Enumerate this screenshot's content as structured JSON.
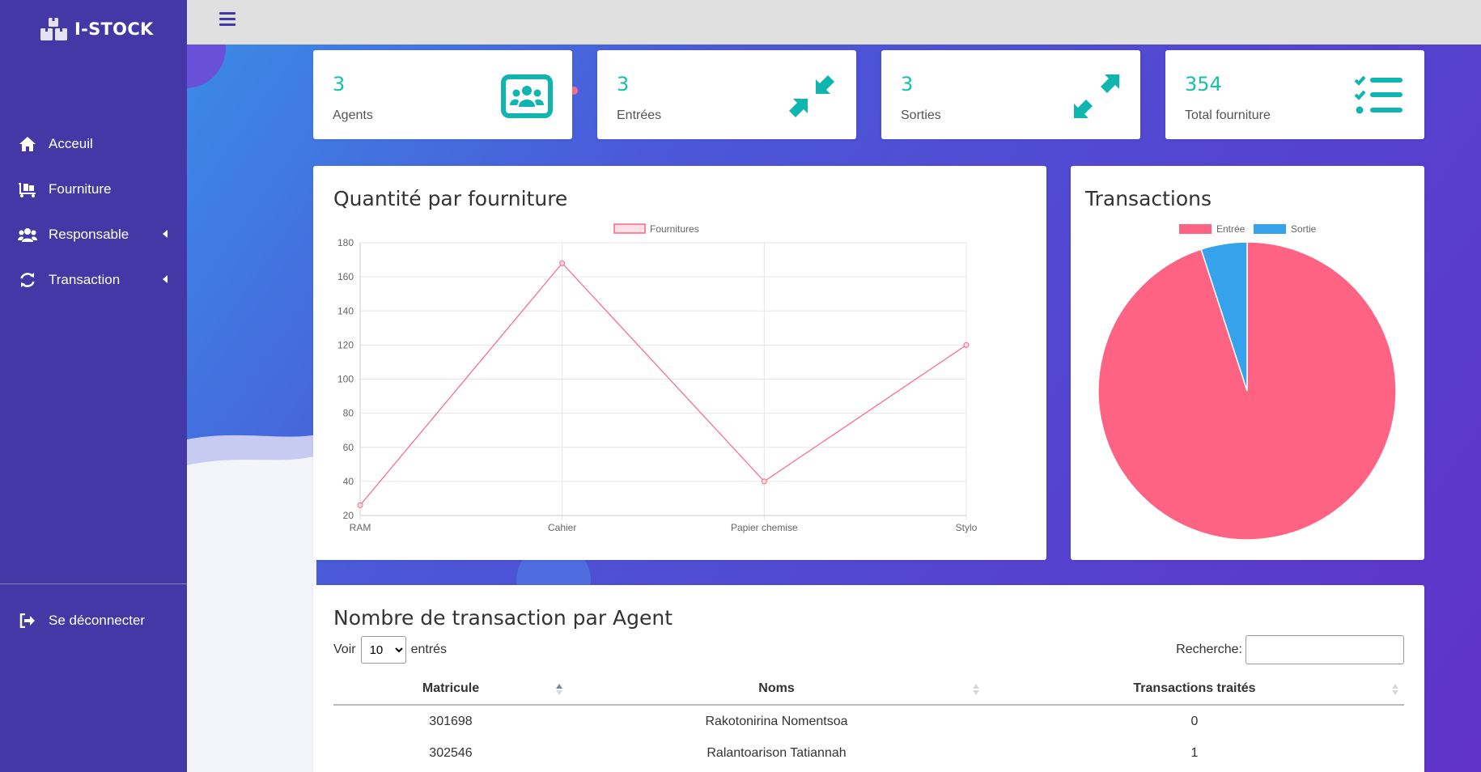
{
  "app": {
    "brand": "I-STOCK"
  },
  "sidebar": {
    "items": [
      {
        "label": "Acceuil",
        "icon": "home-icon",
        "has_submenu": false
      },
      {
        "label": "Fourniture",
        "icon": "dolly-icon",
        "has_submenu": false
      },
      {
        "label": "Responsable",
        "icon": "users-icon",
        "has_submenu": true
      },
      {
        "label": "Transaction",
        "icon": "sync-icon",
        "has_submenu": true
      }
    ],
    "logout_label": "Se déconnecter"
  },
  "stats": [
    {
      "value": "3",
      "label": "Agents",
      "icon": "id-card-users-icon"
    },
    {
      "value": "3",
      "label": "Entrées",
      "icon": "compress-arrows-icon"
    },
    {
      "value": "3",
      "label": "Sorties",
      "icon": "expand-arrows-icon"
    },
    {
      "value": "354",
      "label": "Total fourniture",
      "icon": "checklist-icon"
    }
  ],
  "line_card": {
    "title": "Quantité par fourniture"
  },
  "pie_card": {
    "title": "Transactions"
  },
  "chart_data": [
    {
      "type": "line",
      "categories": [
        "RAM",
        "Cahier",
        "Papier chemise",
        "Stylo"
      ],
      "series": [
        {
          "name": "Fournitures",
          "values": [
            26,
            168,
            40,
            120
          ]
        }
      ],
      "ylim": [
        20,
        180
      ],
      "yticks": [
        20,
        40,
        60,
        80,
        100,
        120,
        140,
        160,
        180
      ],
      "grid": true,
      "legend": "top",
      "colors": {
        "line": "#ff6384",
        "fill": "#ffe0e6"
      }
    },
    {
      "type": "pie",
      "labels": [
        "Entrée",
        "Sortie"
      ],
      "values": [
        95,
        5
      ],
      "colors": [
        "#ff6384",
        "#36a2eb"
      ],
      "legend": "top"
    }
  ],
  "table_card": {
    "title": "Nombre de transaction par Agent",
    "show_label": "Voir",
    "show_value": "10",
    "entries_label": "entrés",
    "search_label": "Recherche:",
    "search_value": "",
    "columns": [
      "Matricule",
      "Noms",
      "Transactions traités"
    ],
    "rows": [
      [
        "301698",
        "Rakotonirina Nomentsoa",
        "0"
      ],
      [
        "302546",
        "Ralantoarison Tatiannah",
        "1"
      ]
    ]
  },
  "colors": {
    "sidebar": "#4338a5",
    "accent": "#17c0a8",
    "icon": "#0fb5ae"
  }
}
